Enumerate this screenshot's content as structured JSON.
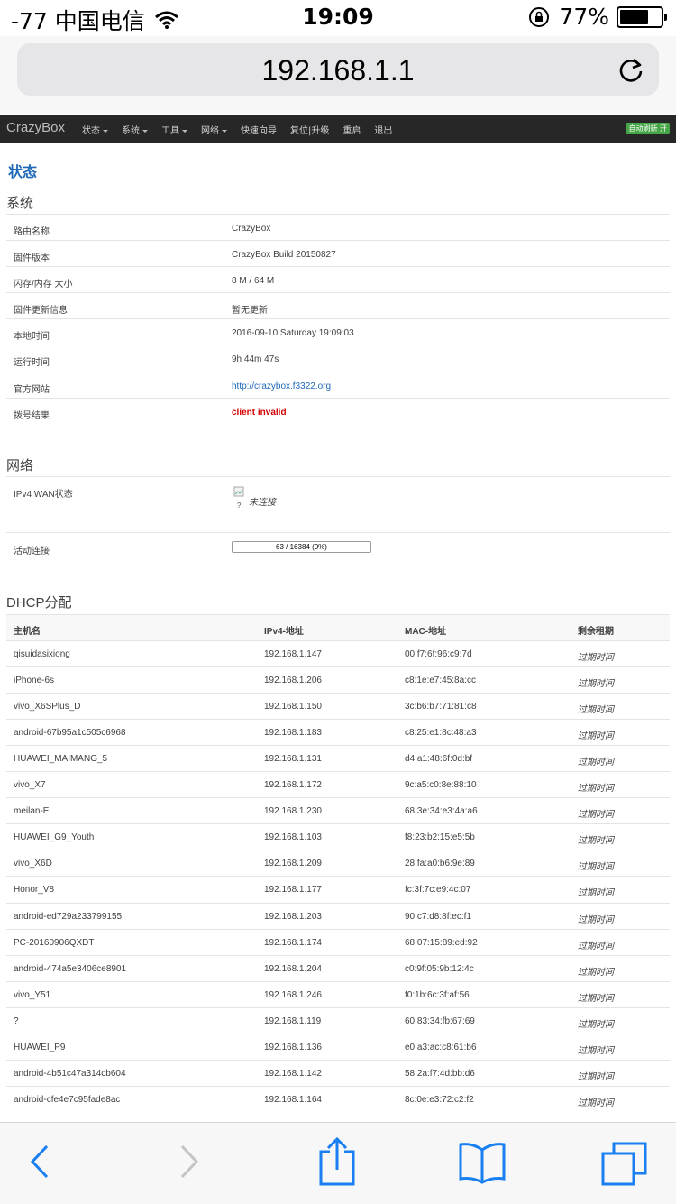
{
  "statusbar": {
    "carrier": "-77 中国电信",
    "time": "19:09",
    "battery_text": "77%",
    "battery_level": 0.77
  },
  "browser": {
    "url": "192.168.1.1"
  },
  "navbar": {
    "brand": "CrazyBox",
    "menu": [
      "状态",
      "系统",
      "工具",
      "网络",
      "快速向导",
      "复位|升级",
      "重启",
      "退出"
    ],
    "auto_refresh": "自动刷新 开"
  },
  "page": {
    "title": "状态"
  },
  "system": {
    "heading": "系统",
    "rows": [
      {
        "k": "路由名称",
        "v": "CrazyBox"
      },
      {
        "k": "固件版本",
        "v": "CrazyBox Build 20150827"
      },
      {
        "k": "闪存/内存 大小",
        "v": "8 M / 64 M"
      },
      {
        "k": "固件更新信息",
        "v": "暂无更新"
      },
      {
        "k": "本地时间",
        "v": "2016-09-10 Saturday 19:09:03"
      },
      {
        "k": "运行时间",
        "v": "9h 44m 47s"
      },
      {
        "k": "官方网站",
        "v": "http://crazybox.f3322.org"
      },
      {
        "k": "拨号结果",
        "v": "client invalid"
      }
    ]
  },
  "network": {
    "heading": "网络",
    "wan_label": "IPv4 WAN状态",
    "wan_icon_q": "?",
    "wan_status": "未连接",
    "conn_label": "活动连接",
    "conn_text": "63 / 16384 (0%)",
    "conn_fraction": 0.004
  },
  "dhcp": {
    "heading": "DHCP分配",
    "headers": [
      "主机名",
      "IPv4-地址",
      "MAC-地址",
      "剩余租期"
    ],
    "rows": [
      [
        "qisuidasixiong",
        "192.168.1.147",
        "00:f7:6f:96:c9:7d",
        "过期时间"
      ],
      [
        "iPhone-6s",
        "192.168.1.206",
        "c8:1e:e7:45:8a:cc",
        "过期时间"
      ],
      [
        "vivo_X6SPlus_D",
        "192.168.1.150",
        "3c:b6:b7:71:81:c8",
        "过期时间"
      ],
      [
        "android-67b95a1c505c6968",
        "192.168.1.183",
        "c8:25:e1:8c:48:a3",
        "过期时间"
      ],
      [
        "HUAWEI_MAIMANG_5",
        "192.168.1.131",
        "d4:a1:48:6f:0d:bf",
        "过期时间"
      ],
      [
        "vivo_X7",
        "192.168.1.172",
        "9c:a5:c0:8e:88:10",
        "过期时间"
      ],
      [
        "meilan-E",
        "192.168.1.230",
        "68:3e:34:e3:4a:a6",
        "过期时间"
      ],
      [
        "HUAWEI_G9_Youth",
        "192.168.1.103",
        "f8:23:b2:15:e5:5b",
        "过期时间"
      ],
      [
        "vivo_X6D",
        "192.168.1.209",
        "28:fa:a0:b6:9e:89",
        "过期时间"
      ],
      [
        "Honor_V8",
        "192.168.1.177",
        "fc:3f:7c:e9:4c:07",
        "过期时间"
      ],
      [
        "android-ed729a233799155",
        "192.168.1.203",
        "90:c7:d8:8f:ec:f1",
        "过期时间"
      ],
      [
        "PC-20160906QXDT",
        "192.168.1.174",
        "68:07:15:89:ed:92",
        "过期时间"
      ],
      [
        "android-474a5e3406ce8901",
        "192.168.1.204",
        "c0:9f:05:9b:12:4c",
        "过期时间"
      ],
      [
        "vivo_Y51",
        "192.168.1.246",
        "f0:1b:6c:3f:af:56",
        "过期时间"
      ],
      [
        "?",
        "192.168.1.119",
        "60:83:34:fb:67:69",
        "过期时间"
      ],
      [
        "HUAWEI_P9",
        "192.168.1.136",
        "e0:a3:ac:c8:61:b6",
        "过期时间"
      ],
      [
        "android-4b51c47a314cb604",
        "192.168.1.142",
        "58:2a:f7:4d:bb:d6",
        "过期时间"
      ],
      [
        "android-cfe4e7c95fade8ac",
        "192.168.1.164",
        "8c:0e:e3:72:c2:f2",
        "过期时间"
      ]
    ]
  },
  "toolbar": {
    "icons": [
      "back-icon",
      "forward-icon",
      "share-icon",
      "bookmarks-icon",
      "tabs-icon"
    ]
  },
  "colors": {
    "ios_blue": "#1a7ff0",
    "link": "#2069b8",
    "error": "#d50000",
    "navbar": "#272727",
    "auto_refresh": "#46a546"
  }
}
